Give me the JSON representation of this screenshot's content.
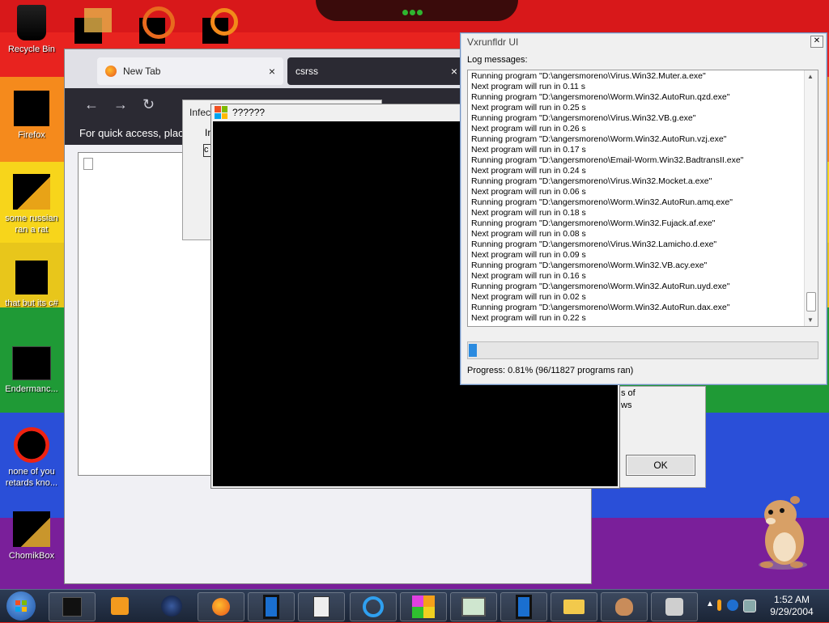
{
  "desktop": {
    "icons": [
      {
        "name": "recycle-bin",
        "label": "Recycle Bin"
      },
      {
        "name": "firefox",
        "label": "Firefox"
      },
      {
        "name": "some-russian",
        "label": "some russian ran a rat"
      },
      {
        "name": "that-but-its-csharp",
        "label": "that but its c#"
      },
      {
        "name": "endermanch",
        "label": "Endermanc..."
      },
      {
        "name": "none-of-you",
        "label": "none of you retards kno..."
      },
      {
        "name": "chomikbox",
        "label": "ChomikBox"
      }
    ]
  },
  "browser": {
    "tabs": [
      {
        "label": "New Tab",
        "close": "×"
      },
      {
        "label": "csrss",
        "close": "×"
      }
    ],
    "nav": {
      "back": "←",
      "forward": "→",
      "reload": "↻"
    },
    "quick_access_text": "For quick access, place y"
  },
  "infected_dialog": {
    "title": "Infec",
    "line": "Ir",
    "box_text": "c"
  },
  "message_box": {
    "text_line_1": "s of",
    "text_line_2": "ws",
    "ok_label": "OK"
  },
  "console_window": {
    "title": "??????"
  },
  "vxrunfldr": {
    "title": "Vxrunfldr UI",
    "close": "✕",
    "log_label": "Log messages:",
    "log_lines": [
      "Running program \"D:\\angersmoreno\\Virus.Win32.Muter.a.exe\"",
      "Next program will run in 0.11 s",
      "Running program \"D:\\angersmoreno\\Worm.Win32.AutoRun.qzd.exe\"",
      "Next program will run in 0.25 s",
      "Running program \"D:\\angersmoreno\\Virus.Win32.VB.g.exe\"",
      "Next program will run in 0.26 s",
      "Running program \"D:\\angersmoreno\\Worm.Win32.AutoRun.vzj.exe\"",
      "Next program will run in 0.17 s",
      "Running program \"D:\\angersmoreno\\Email-Worm.Win32.BadtransII.exe\"",
      "Next program will run in 0.24 s",
      "Running program \"D:\\angersmoreno\\Virus.Win32.Mocket.a.exe\"",
      "Next program will run in 0.06 s",
      "Running program \"D:\\angersmoreno\\Worm.Win32.AutoRun.amq.exe\"",
      "Next program will run in 0.18 s",
      "Running program \"D:\\angersmoreno\\Worm.Win32.Fujack.af.exe\"",
      "Next program will run in 0.08 s",
      "Running program \"D:\\angersmoreno\\Virus.Win32.Lamicho.d.exe\"",
      "Next program will run in 0.09 s",
      "Running program \"D:\\angersmoreno\\Worm.Win32.VB.acy.exe\"",
      "Next program will run in 0.16 s",
      "Running program \"D:\\angersmoreno\\Worm.Win32.AutoRun.uyd.exe\"",
      "Next program will run in 0.02 s",
      "Running program \"D:\\angersmoreno\\Worm.Win32.AutoRun.dax.exe\"",
      "Next program will run in 0.22 s"
    ],
    "progress_fraction": 0.0081,
    "progress_text": "Progress: 0.81% (96/11827 programs ran)"
  },
  "taskbar": {
    "items": [
      {
        "name": "start-button",
        "icon": "windows-orb-icon"
      },
      {
        "name": "taskbar-item-1",
        "icon": "black-box-icon"
      },
      {
        "name": "taskbar-item-2",
        "icon": "media-player-icon"
      },
      {
        "name": "taskbar-item-3",
        "icon": "dark-globe-icon"
      },
      {
        "name": "taskbar-item-4",
        "icon": "firefox-icon"
      },
      {
        "name": "taskbar-item-5",
        "icon": "phone-icon"
      },
      {
        "name": "taskbar-item-6",
        "icon": "document-icon"
      },
      {
        "name": "taskbar-item-7",
        "icon": "ie-icon"
      },
      {
        "name": "taskbar-item-8",
        "icon": "colored-squares-icon"
      },
      {
        "name": "taskbar-item-9",
        "icon": "window-icon"
      },
      {
        "name": "taskbar-item-10",
        "icon": "phone-icon"
      },
      {
        "name": "taskbar-item-11",
        "icon": "folder-icon"
      },
      {
        "name": "taskbar-item-12",
        "icon": "hamster-icon"
      },
      {
        "name": "taskbar-item-13",
        "icon": "network-icon"
      }
    ],
    "tray_arrow": "▲",
    "clock_time": "1:52 AM",
    "clock_date": "9/29/2004"
  },
  "colors": {
    "progress_fill": "#2b8be0",
    "titlebar_accent": "#6f8fbf",
    "browser_dark": "#2b2a33"
  }
}
